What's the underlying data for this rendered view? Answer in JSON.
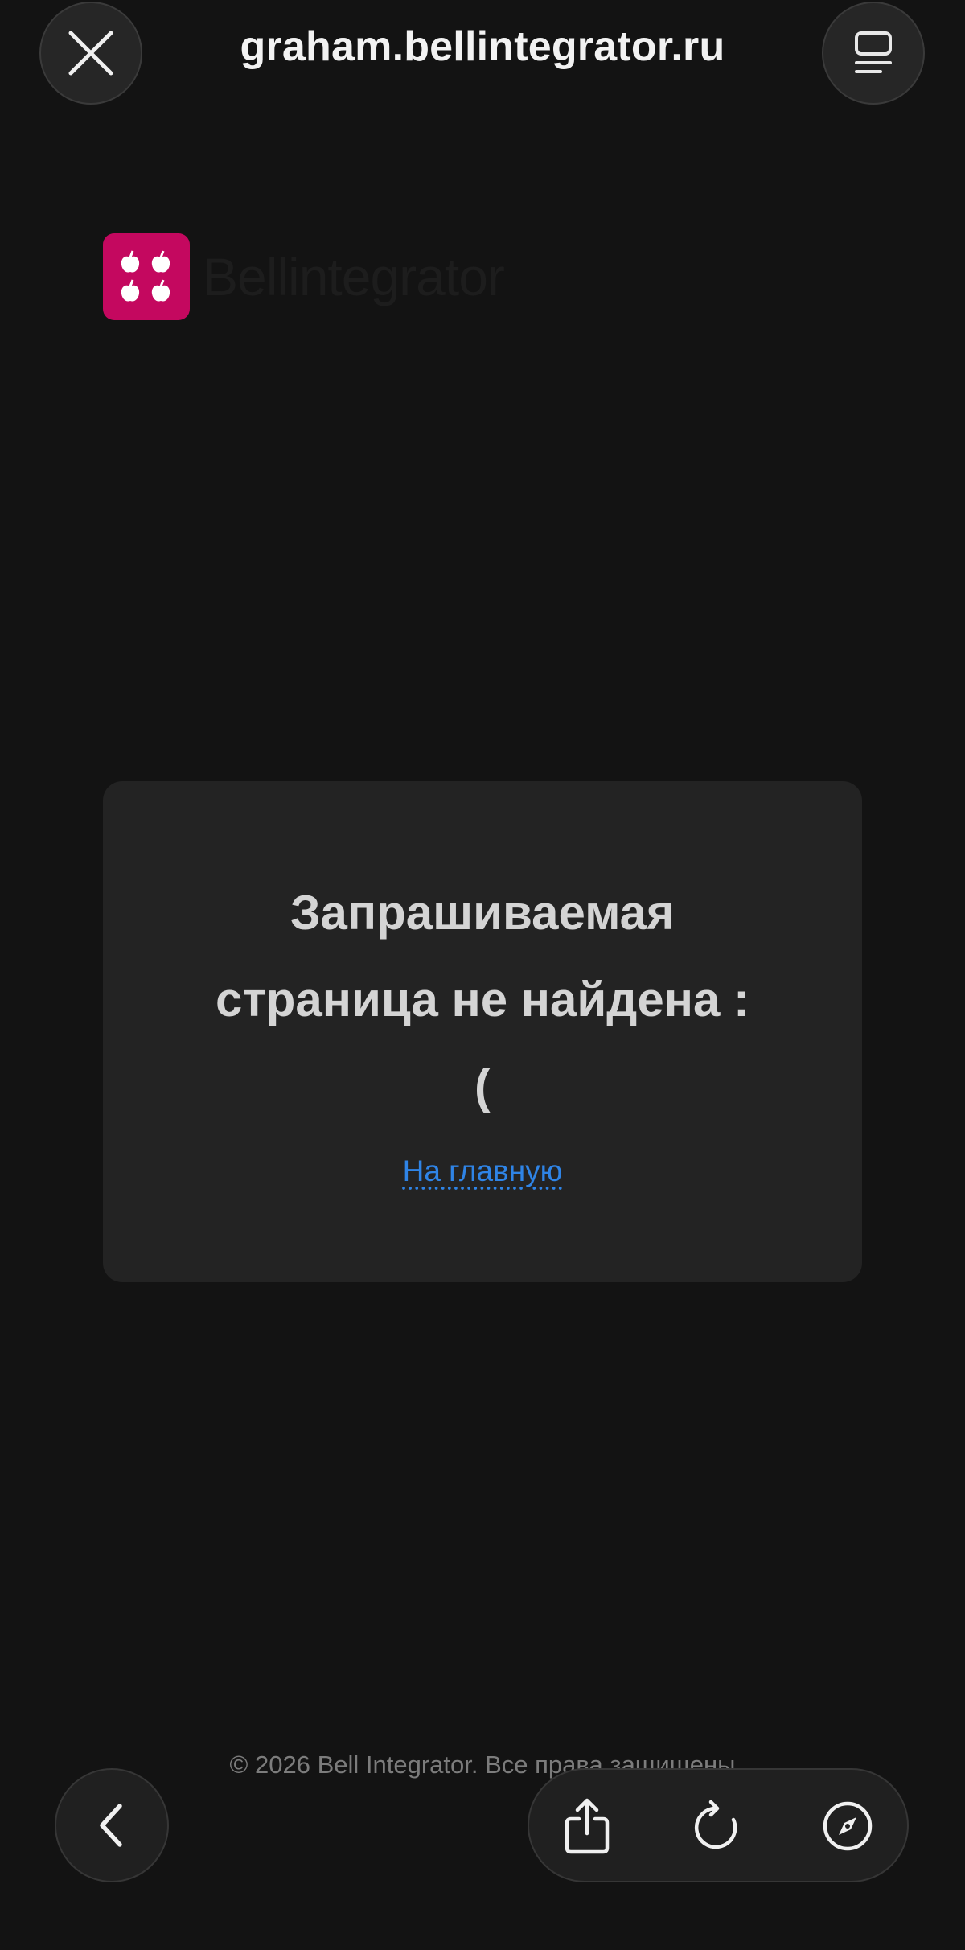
{
  "browser": {
    "url": "graham.bellintegrator.ru",
    "close_icon": "close-icon",
    "tabs_icon": "tabs-icon"
  },
  "logo": {
    "text": "Bellintegrator",
    "mark_color": "#c4085f"
  },
  "error_card": {
    "title": "Запрашиваемая\nстраница не найдена :\n(",
    "link_label": "На главную",
    "link_color": "#2f84e6"
  },
  "footer": {
    "copyright": "© 2026 Bell Integrator. Все права защищены"
  },
  "toolbar": {
    "back_icon": "chevron-left-icon",
    "share_icon": "share-icon",
    "reload_icon": "reload-icon",
    "compass_icon": "compass-icon"
  },
  "colors": {
    "background": "#131313",
    "card": "#232323",
    "title_text": "#d4d4d4"
  }
}
